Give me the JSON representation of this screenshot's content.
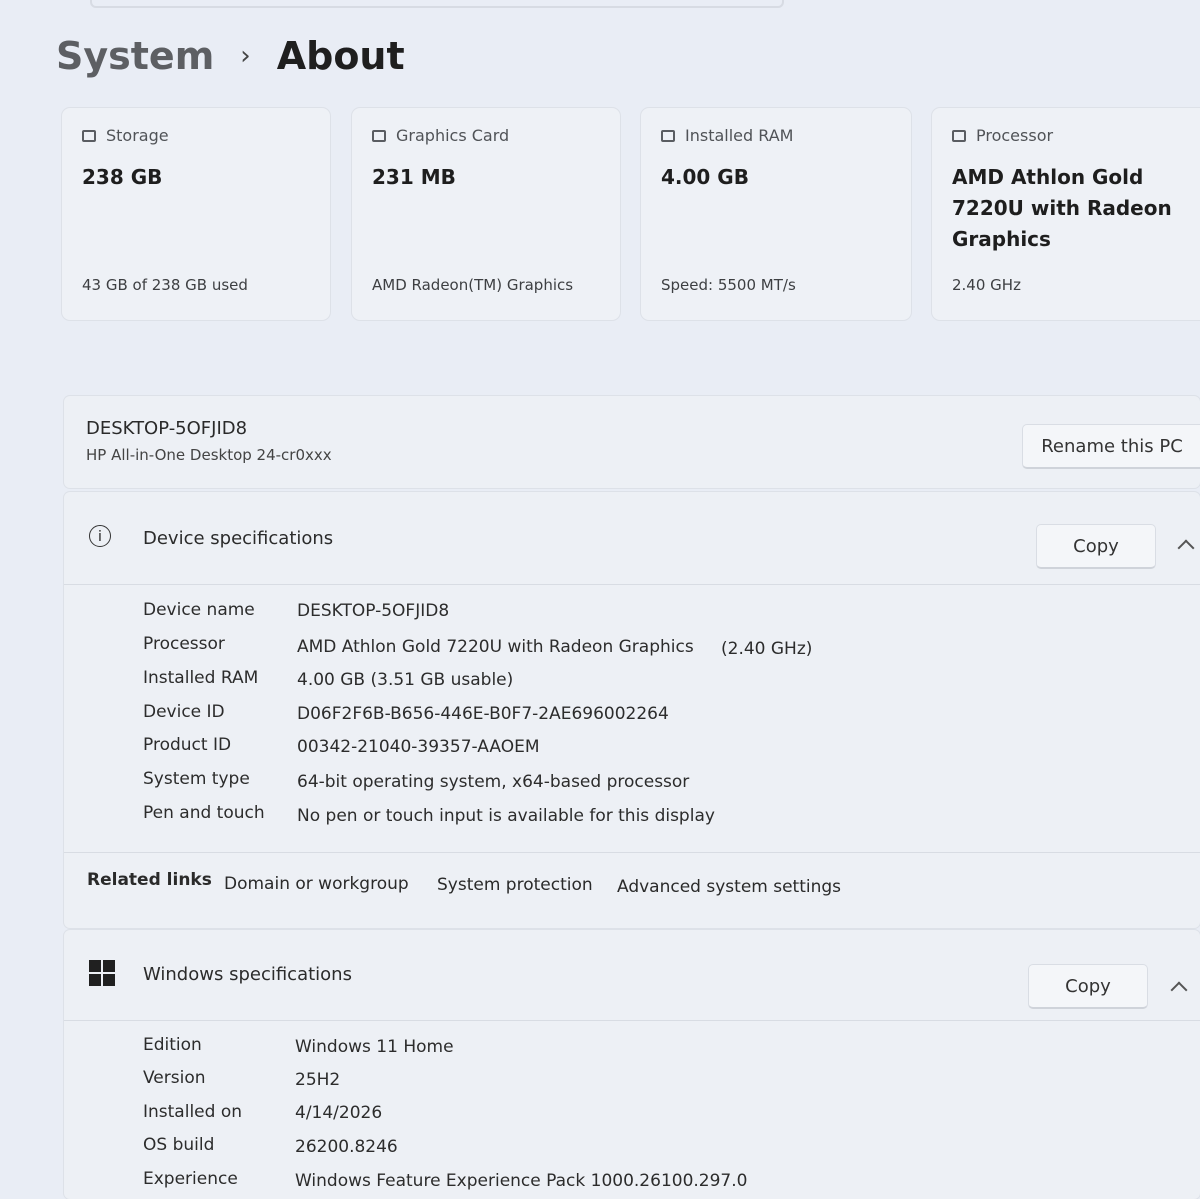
{
  "breadcrumb": {
    "root": "System",
    "separator": "›",
    "page": "About"
  },
  "cards": {
    "storage": {
      "label": "Storage",
      "value": "238 GB",
      "sub": "43 GB of 238 GB used"
    },
    "graphics": {
      "label": "Graphics Card",
      "value": "231 MB",
      "sub": "AMD Radeon(TM) Graphics"
    },
    "ram": {
      "label": "Installed RAM",
      "value": "4.00 GB",
      "sub": "Speed: 5500 MT/s"
    },
    "processor": {
      "label": "Processor",
      "value": "AMD Athlon Gold 7220U with Radeon Graphics",
      "sub": "2.40 GHz"
    }
  },
  "pc": {
    "name": "DESKTOP-5OFJID8",
    "model": "HP All-in-One Desktop 24-cr0xxx",
    "rename_label": "Rename this PC"
  },
  "device_specs": {
    "title": "Device specifications",
    "copy_label": "Copy",
    "rows": [
      {
        "label": "Device name",
        "value": "DESKTOP-5OFJID8"
      },
      {
        "label": "Processor",
        "value": "AMD Athlon Gold 7220U with Radeon Graphics",
        "extra": "(2.40 GHz)"
      },
      {
        "label": "Installed RAM",
        "value": "4.00 GB (3.51 GB usable)"
      },
      {
        "label": "Device ID",
        "value": "D06F2F6B-B656-446E-B0F7-2AE696002264"
      },
      {
        "label": "Product ID",
        "value": "00342-21040-39357-AAOEM"
      },
      {
        "label": "System type",
        "value": "64-bit operating system, x64-based processor"
      },
      {
        "label": "Pen and touch",
        "value": "No pen or touch input is available for this display"
      }
    ]
  },
  "related_links": {
    "title": "Related links",
    "items": [
      "Domain or workgroup",
      "System protection",
      "Advanced system settings"
    ]
  },
  "windows_specs": {
    "title": "Windows specifications",
    "copy_label": "Copy",
    "rows": [
      {
        "label": "Edition",
        "value": "Windows 11 Home"
      },
      {
        "label": "Version",
        "value": "25H2"
      },
      {
        "label": "Installed on",
        "value": "4/14/2026"
      },
      {
        "label": "OS build",
        "value": "26200.8246"
      },
      {
        "label": "Experience",
        "value": "Windows Feature Experience Pack 1000.26100.297.0"
      }
    ]
  }
}
